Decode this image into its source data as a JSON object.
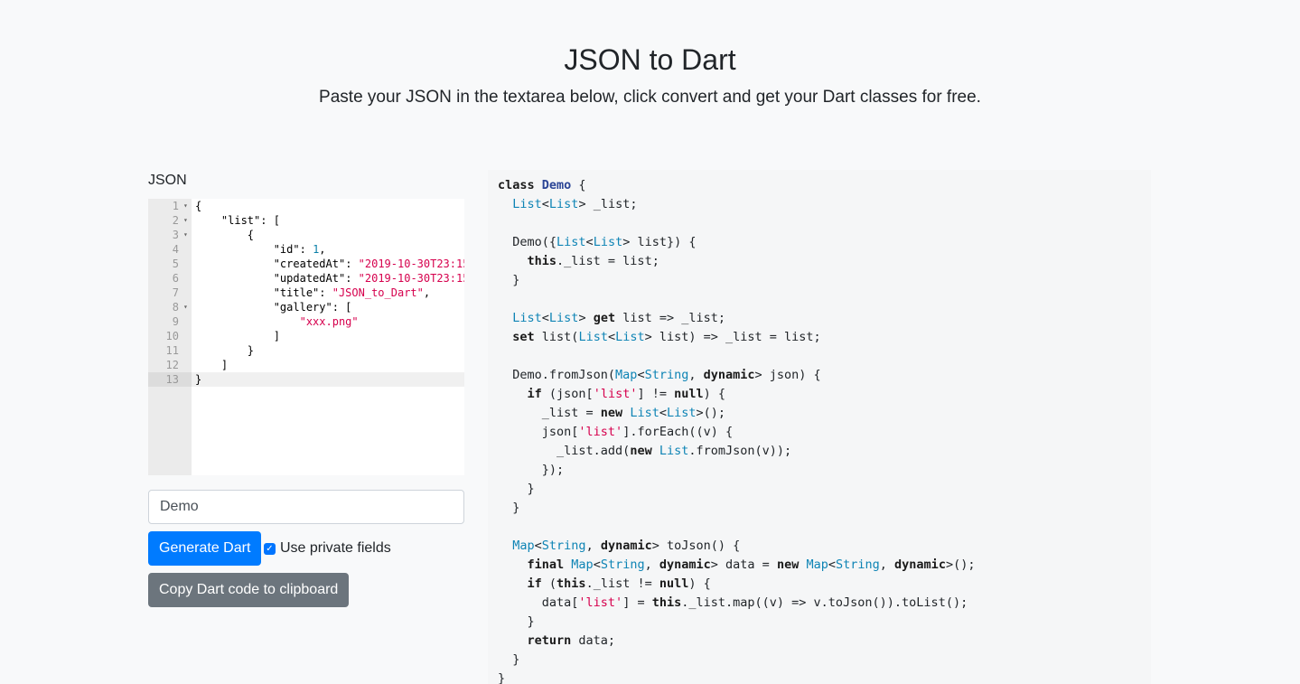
{
  "header": {
    "title": "JSON to Dart",
    "subtitle": "Paste your JSON in the textarea below, click convert and get your Dart classes for free."
  },
  "editor": {
    "label": "JSON",
    "active_line": 13,
    "lines": [
      {
        "n": "1",
        "fold": true,
        "tokens": [
          [
            "p",
            "{"
          ]
        ]
      },
      {
        "n": "2",
        "fold": true,
        "tokens": [
          [
            "p",
            "    "
          ],
          [
            "k",
            "\"list\""
          ],
          [
            "p",
            ": ["
          ]
        ]
      },
      {
        "n": "3",
        "fold": true,
        "tokens": [
          [
            "p",
            "        {"
          ]
        ]
      },
      {
        "n": "4",
        "fold": false,
        "tokens": [
          [
            "p",
            "            "
          ],
          [
            "k",
            "\"id\""
          ],
          [
            "p",
            ": "
          ],
          [
            "n",
            "1"
          ],
          [
            "p",
            ","
          ]
        ]
      },
      {
        "n": "5",
        "fold": false,
        "tokens": [
          [
            "p",
            "            "
          ],
          [
            "k",
            "\"createdAt\""
          ],
          [
            "p",
            ": "
          ],
          [
            "s",
            "\"2019-10-30T23:15"
          ]
        ]
      },
      {
        "n": "6",
        "fold": false,
        "tokens": [
          [
            "p",
            "            "
          ],
          [
            "k",
            "\"updatedAt\""
          ],
          [
            "p",
            ": "
          ],
          [
            "s",
            "\"2019-10-30T23:15"
          ]
        ]
      },
      {
        "n": "7",
        "fold": false,
        "tokens": [
          [
            "p",
            "            "
          ],
          [
            "k",
            "\"title\""
          ],
          [
            "p",
            ": "
          ],
          [
            "s",
            "\"JSON_to_Dart\""
          ],
          [
            "p",
            ","
          ]
        ]
      },
      {
        "n": "8",
        "fold": true,
        "tokens": [
          [
            "p",
            "            "
          ],
          [
            "k",
            "\"gallery\""
          ],
          [
            "p",
            ": ["
          ]
        ]
      },
      {
        "n": "9",
        "fold": false,
        "tokens": [
          [
            "p",
            "                "
          ],
          [
            "s",
            "\"xxx.png\""
          ]
        ]
      },
      {
        "n": "10",
        "fold": false,
        "tokens": [
          [
            "p",
            "            ]"
          ]
        ]
      },
      {
        "n": "11",
        "fold": false,
        "tokens": [
          [
            "p",
            "        }"
          ]
        ]
      },
      {
        "n": "12",
        "fold": false,
        "tokens": [
          [
            "p",
            "    ]"
          ]
        ]
      },
      {
        "n": "13",
        "fold": false,
        "tokens": [
          [
            "p",
            "}"
          ]
        ]
      }
    ]
  },
  "class_name_input": {
    "value": "Demo"
  },
  "generate_button": {
    "label": "Generate Dart"
  },
  "private_fields": {
    "label": "Use private fields",
    "checked": true
  },
  "copy_button": {
    "label": "Copy Dart code to clipboard"
  },
  "output": {
    "lines": [
      [
        [
          "k",
          "class "
        ],
        [
          "c",
          "Demo"
        ],
        [
          "p",
          " {"
        ]
      ],
      [
        [
          "p",
          "  "
        ],
        [
          "t",
          "List"
        ],
        [
          "p",
          "<"
        ],
        [
          "t",
          "List"
        ],
        [
          "p",
          "> _list;"
        ]
      ],
      [],
      [
        [
          "p",
          "  Demo({"
        ],
        [
          "t",
          "List"
        ],
        [
          "p",
          "<"
        ],
        [
          "t",
          "List"
        ],
        [
          "p",
          "> list}) {"
        ]
      ],
      [
        [
          "p",
          "    "
        ],
        [
          "k",
          "this"
        ],
        [
          "p",
          "._list = list;"
        ]
      ],
      [
        [
          "p",
          "  }"
        ]
      ],
      [],
      [
        [
          "p",
          "  "
        ],
        [
          "t",
          "List"
        ],
        [
          "p",
          "<"
        ],
        [
          "t",
          "List"
        ],
        [
          "p",
          "> "
        ],
        [
          "k",
          "get"
        ],
        [
          "p",
          " list => _list;"
        ]
      ],
      [
        [
          "p",
          "  "
        ],
        [
          "k",
          "set"
        ],
        [
          "p",
          " list("
        ],
        [
          "t",
          "List"
        ],
        [
          "p",
          "<"
        ],
        [
          "t",
          "List"
        ],
        [
          "p",
          "> list) => _list = list;"
        ]
      ],
      [],
      [
        [
          "p",
          "  Demo.fromJson("
        ],
        [
          "t",
          "Map"
        ],
        [
          "p",
          "<"
        ],
        [
          "t",
          "String"
        ],
        [
          "p",
          ", "
        ],
        [
          "k",
          "dynamic"
        ],
        [
          "p",
          "> json) {"
        ]
      ],
      [
        [
          "p",
          "    "
        ],
        [
          "k",
          "if"
        ],
        [
          "p",
          " (json["
        ],
        [
          "s",
          "'list'"
        ],
        [
          "p",
          "] != "
        ],
        [
          "k",
          "null"
        ],
        [
          "p",
          ") {"
        ]
      ],
      [
        [
          "p",
          "      _list = "
        ],
        [
          "k",
          "new"
        ],
        [
          "p",
          " "
        ],
        [
          "t",
          "List"
        ],
        [
          "p",
          "<"
        ],
        [
          "t",
          "List"
        ],
        [
          "p",
          ">();"
        ]
      ],
      [
        [
          "p",
          "      json["
        ],
        [
          "s",
          "'list'"
        ],
        [
          "p",
          "].forEach((v) {"
        ]
      ],
      [
        [
          "p",
          "        _list.add("
        ],
        [
          "k",
          "new"
        ],
        [
          "p",
          " "
        ],
        [
          "t",
          "List"
        ],
        [
          "p",
          ".fromJson(v));"
        ]
      ],
      [
        [
          "p",
          "      });"
        ]
      ],
      [
        [
          "p",
          "    }"
        ]
      ],
      [
        [
          "p",
          "  }"
        ]
      ],
      [],
      [
        [
          "p",
          "  "
        ],
        [
          "t",
          "Map"
        ],
        [
          "p",
          "<"
        ],
        [
          "t",
          "String"
        ],
        [
          "p",
          ", "
        ],
        [
          "k",
          "dynamic"
        ],
        [
          "p",
          "> toJson() {"
        ]
      ],
      [
        [
          "p",
          "    "
        ],
        [
          "k",
          "final"
        ],
        [
          "p",
          " "
        ],
        [
          "t",
          "Map"
        ],
        [
          "p",
          "<"
        ],
        [
          "t",
          "String"
        ],
        [
          "p",
          ", "
        ],
        [
          "k",
          "dynamic"
        ],
        [
          "p",
          "> data = "
        ],
        [
          "k",
          "new"
        ],
        [
          "p",
          " "
        ],
        [
          "t",
          "Map"
        ],
        [
          "p",
          "<"
        ],
        [
          "t",
          "String"
        ],
        [
          "p",
          ", "
        ],
        [
          "k",
          "dynamic"
        ],
        [
          "p",
          ">();"
        ]
      ],
      [
        [
          "p",
          "    "
        ],
        [
          "k",
          "if"
        ],
        [
          "p",
          " ("
        ],
        [
          "k",
          "this"
        ],
        [
          "p",
          "._list != "
        ],
        [
          "k",
          "null"
        ],
        [
          "p",
          ") {"
        ]
      ],
      [
        [
          "p",
          "      data["
        ],
        [
          "s",
          "'list'"
        ],
        [
          "p",
          "] = "
        ],
        [
          "k",
          "this"
        ],
        [
          "p",
          "._list.map((v) => v.toJson()).toList();"
        ]
      ],
      [
        [
          "p",
          "    }"
        ]
      ],
      [
        [
          "p",
          "    "
        ],
        [
          "k",
          "return"
        ],
        [
          "p",
          " data;"
        ]
      ],
      [
        [
          "p",
          "  }"
        ]
      ],
      [
        [
          "p",
          "}"
        ]
      ]
    ]
  }
}
